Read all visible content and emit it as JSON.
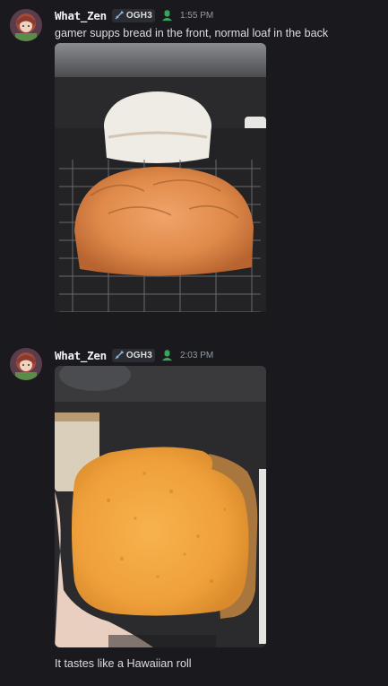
{
  "messages": [
    {
      "author": "What_Zen",
      "tag": "OGH3",
      "time": "1:55 PM",
      "text": "gamer supps bread in the front, normal loaf in the back",
      "image_desc": "photo-two-loaves-on-rack"
    },
    {
      "author": "What_Zen",
      "tag": "OGH3",
      "time": "2:03 PM",
      "text": "It tastes like a Hawaiian roll",
      "image_desc": "photo-orange-bread-slice-in-hand"
    }
  ],
  "colors": {
    "background": "#1a1a1e",
    "username": "#f2f3f5",
    "text": "#dbdee1",
    "timestamp": "#949ba4",
    "badge_green": "#3ba55c"
  }
}
